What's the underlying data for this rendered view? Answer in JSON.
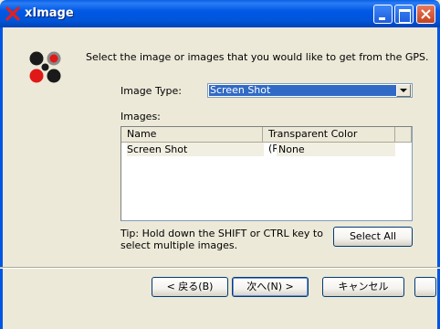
{
  "window": {
    "title": "xImage",
    "icon": "ximage-logo-icon"
  },
  "prompt": "Select the image or images that you would like to get from the GPS.",
  "image_type": {
    "label": "Image Type:",
    "selected": "Screen Shot"
  },
  "images": {
    "label": "Images:",
    "columns": [
      "Name",
      "Transparent Color (R,G,B)"
    ],
    "rows": [
      {
        "name": "Screen Shot",
        "transparent_color": "None"
      }
    ]
  },
  "tip": "Tip: Hold down the SHIFT or CTRL key to select multiple images.",
  "buttons": {
    "select_all": "Select All",
    "back": "< 戻る(B)",
    "next": "次へ(N) >",
    "cancel": "キャンセル"
  },
  "colors": {
    "titlebar": "#0058e6",
    "selection": "#316ac5",
    "dialog_bg": "#ece9d8",
    "logo_red": "#e01818",
    "logo_dark": "#1a1a1a"
  }
}
